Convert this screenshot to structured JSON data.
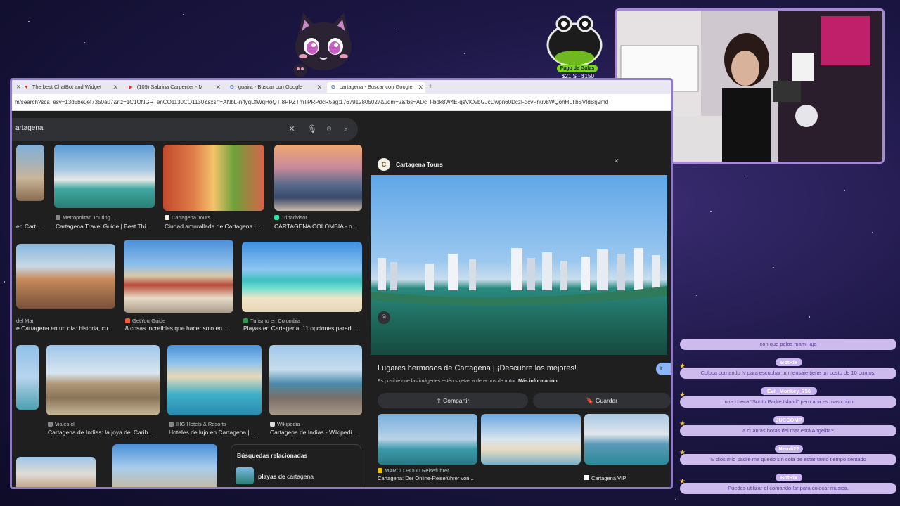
{
  "browser": {
    "tabs": [
      {
        "title": "The best ChatBot and Widget",
        "favicon": "heart"
      },
      {
        "title": "(109) Sabrina Carpenter - M",
        "favicon": "youtube"
      },
      {
        "title": "guaira - Buscar con Google",
        "favicon": "google"
      },
      {
        "title": "cartagena - Buscar con Google",
        "favicon": "google"
      }
    ],
    "new_tab": "+",
    "url": "m/search?sca_esv=13d5be0ef7350a07&rlz=1C1ONGR_enCO1130CO1130&sxsrf=ANbL-n4yqDfWqHoQTI8PPZTmTPRPdcR5ag:1767912805027&udm=2&fbs=ADc_l-bpk8W4E-qsVlOvbGJcDwpn60DczFdcvPnuv8WQohHLTbSVIdBrj9md"
  },
  "search": {
    "query": "artagena"
  },
  "results": {
    "row1": [
      {
        "source": "",
        "caption": "en Cart..."
      },
      {
        "source": "Metropolitan Touring",
        "caption": "Cartagena Travel Guide | Best Thi..."
      },
      {
        "source": "Cartagena Tours",
        "caption": "Ciudad amurallada de Cartagena |..."
      },
      {
        "source": "Tripadvisor",
        "caption": "CARTAGENA COLOMBIA - o..."
      }
    ],
    "row2": [
      {
        "source": "del Mar",
        "caption": "e Cartagena en un día: historia, cu..."
      },
      {
        "source": "GetYourGuide",
        "caption": "8 cosas increíbles que hacer solo en ..."
      },
      {
        "source": "Turismo en Colombia",
        "caption": "Playas en Cartagena: 11 opciones paradi..."
      }
    ],
    "row3": [
      {
        "source": "Viajes.cl",
        "caption": "Cartagena de Indias: la joya del Carib..."
      },
      {
        "source": "IHG Hotels & Resorts",
        "caption": "Hoteles de lujo en Cartagena | ..."
      },
      {
        "source": "Wikipedia",
        "caption": "Cartagena de Indias - Wikipedi..."
      }
    ]
  },
  "related": {
    "title": "Búsquedas relacionadas",
    "item_bold": "playas de",
    "item_rest": " cartagena"
  },
  "preview": {
    "source_logo": "C",
    "source": "Cartagena Tours",
    "title": "Lugares hermosos de Cartagena | ¡Descubre los mejores!",
    "visit": "Ir",
    "note": "Es posible que las imágenes estén sujetas a derechos de autor.",
    "note_link": "Más información",
    "share": "Compartir",
    "save": "Guardar",
    "thumbs": [
      {
        "source": "MARCO POLO Reiseführer",
        "caption": "Cartagena: Der Online-Reiseführer von..."
      },
      {
        "source": "",
        "caption": ""
      },
      {
        "source": "",
        "caption": "Cartagena VIP"
      }
    ]
  },
  "stream": {
    "goal_label": "Pago de Gafas",
    "goal_amount": "$21 S - $150"
  },
  "chat": [
    {
      "user": "",
      "text": "con que pelos mami jaja"
    },
    {
      "user": "BotRix",
      "text": "Coloca comando !v para escuchar tu mensaje tiene un costo de 10 puntos."
    },
    {
      "user": "Evil_Monkey_756",
      "text": "mira checa \"South Padre Island\" pero aca es mas chico"
    },
    {
      "user": "JUCCOMP",
      "text": "a cuantas horas del mar está Angelita?"
    },
    {
      "user": "Neudi22",
      "text": "!v dios mío padre me quedo sin cola de estar tanto tiempo sentado"
    },
    {
      "user": "BotRix",
      "text": "Puedes utilizar el comando !sr para colocar musica."
    }
  ],
  "colors": {
    "accent": "#8ab4f8",
    "chat_bubble": "#cdbbee",
    "frame": "#8f7bc2",
    "goal": "#7ed321"
  }
}
